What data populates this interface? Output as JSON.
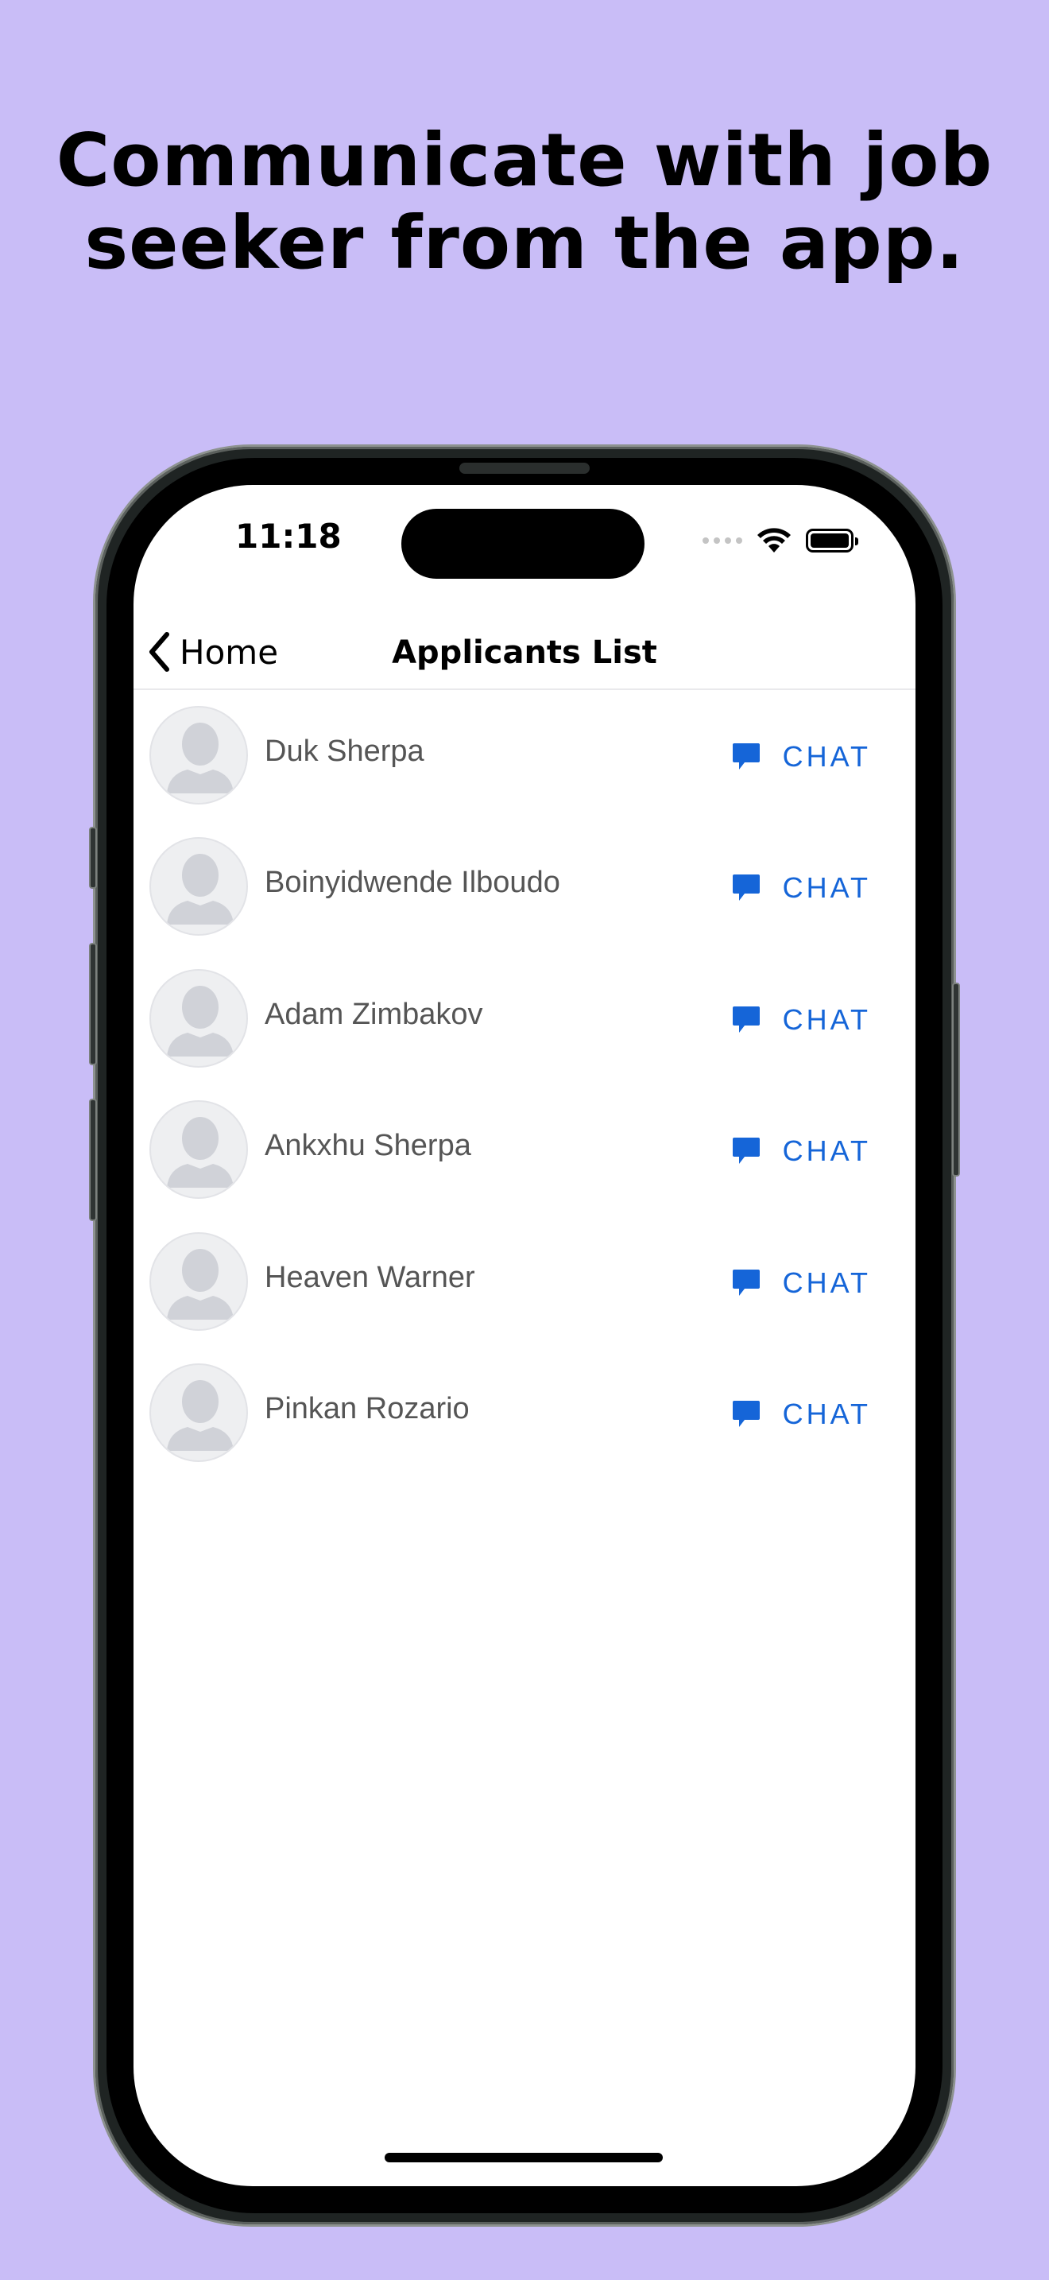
{
  "page": {
    "headline_line1": "Communicate with job",
    "headline_line2": "seeker from the app.",
    "background_color": "#c9bdf7"
  },
  "status_bar": {
    "time": "11:18",
    "icons": [
      "cellular-dots-icon",
      "wifi-icon",
      "battery-icon"
    ]
  },
  "navbar": {
    "back_label": "Home",
    "title": "Applicants List"
  },
  "applicants": [
    {
      "name": "Duk Sherpa",
      "action": "CHAT"
    },
    {
      "name": "Boinyidwende Ilboudo",
      "action": "CHAT"
    },
    {
      "name": "Adam Zimbakov",
      "action": "CHAT"
    },
    {
      "name": "Ankxhu Sherpa",
      "action": "CHAT"
    },
    {
      "name": "Heaven Warner",
      "action": "CHAT"
    },
    {
      "name": "Pinkan Rozario",
      "action": "CHAT"
    }
  ],
  "colors": {
    "accent": "#1565d8",
    "name_text": "#555555"
  }
}
